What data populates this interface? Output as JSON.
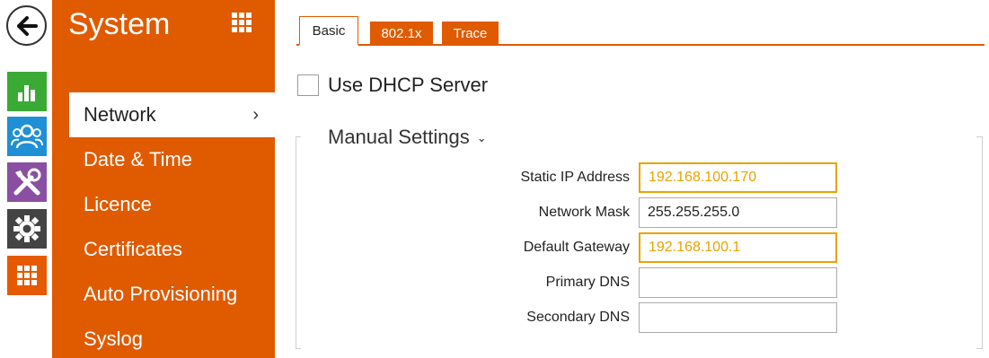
{
  "sidebar": {
    "title": "System",
    "items": [
      {
        "label": "Network",
        "active": true,
        "chevron": "›"
      },
      {
        "label": "Date & Time"
      },
      {
        "label": "Licence"
      },
      {
        "label": "Certificates"
      },
      {
        "label": "Auto Provisioning"
      },
      {
        "label": "Syslog"
      }
    ]
  },
  "rail": {
    "icons": [
      "back-arrow-icon",
      "status-chart-icon",
      "directory-users-icon",
      "hardware-tools-icon",
      "services-gear-icon",
      "system-grid-icon"
    ]
  },
  "tabs": [
    {
      "label": "Basic",
      "active": true
    },
    {
      "label": "802.1x"
    },
    {
      "label": "Trace"
    }
  ],
  "dhcp": {
    "label": "Use DHCP Server",
    "checked": false
  },
  "manual": {
    "title": "Manual Settings",
    "chevron": "⌄",
    "fields": [
      {
        "label": "Static IP Address",
        "value": "192.168.100.170",
        "highlight": true
      },
      {
        "label": "Network Mask",
        "value": "255.255.255.0",
        "highlight": false
      },
      {
        "label": "Default Gateway",
        "value": "192.168.100.1",
        "highlight": true
      },
      {
        "label": "Primary DNS",
        "value": "",
        "highlight": false
      },
      {
        "label": "Secondary DNS",
        "value": "",
        "highlight": false
      }
    ]
  },
  "colors": {
    "brand_orange": "#e05a00",
    "highlight_amber": "#e8a300",
    "status_green": "#3aaa35",
    "directory_blue": "#1f8fd6",
    "hardware_purple": "#8a4fa3",
    "services_gray": "#444444"
  }
}
